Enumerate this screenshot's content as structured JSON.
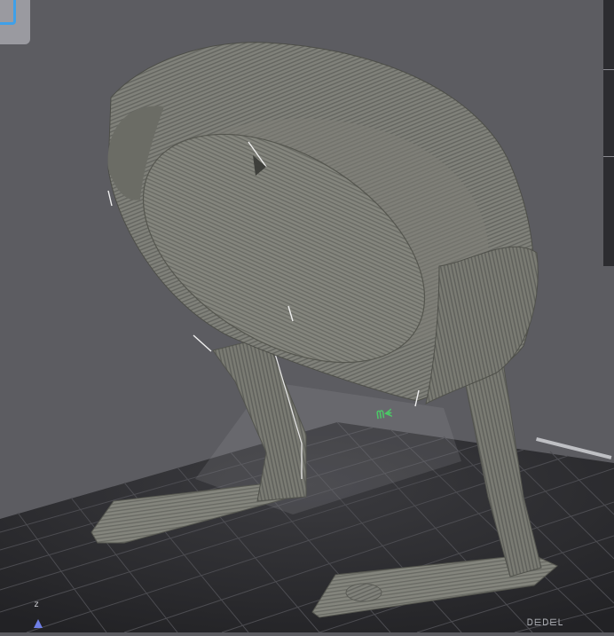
{
  "viewport": {
    "axis_label": "z",
    "bed_edge_text": "Ꭰ⋿Ꭰ⋿Ꮮ",
    "model_name": "",
    "colors": {
      "background": "#5c5c61",
      "bed": "#2b2b2e",
      "bed_grid": "#505055",
      "model": "#7f8077",
      "accent_axis": "#6f7fe6",
      "widget_border": "#3fa0e8",
      "bed_logo": "#3ad05a"
    },
    "icons": {
      "corner_widget": "view-cube-icon",
      "axis_indicator": "z-axis-icon"
    }
  }
}
